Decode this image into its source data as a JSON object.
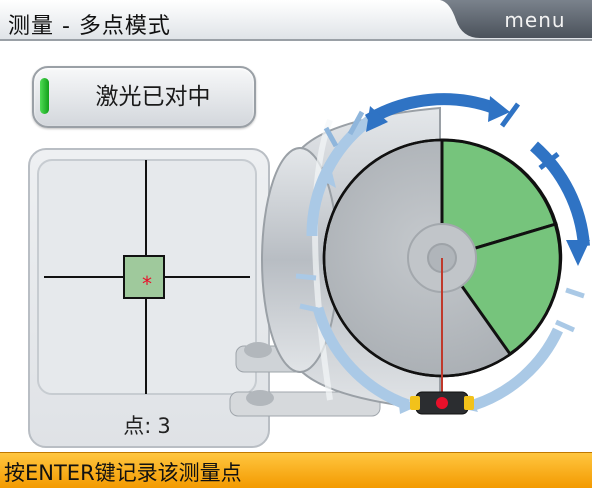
{
  "title_bar": {
    "title": "测量 - 多点模式",
    "menu_label": "menu"
  },
  "laser_status": {
    "label": "激光已对中",
    "indicator_color": "#22b02a"
  },
  "target": {
    "point_label": "点:",
    "point_count": "3"
  },
  "status_bar": {
    "prompt": "按ENTER键记录该测量点"
  },
  "colors": {
    "title_bar": "#e9ecef",
    "menu_tab": "#5e6670",
    "status_bar": "#f8a81a",
    "measured_sector": "#76c47c",
    "rotation_arrow": "#2f73c4",
    "rotation_arrow_light": "#aac9e6",
    "laser_dot": "#e8102a"
  }
}
